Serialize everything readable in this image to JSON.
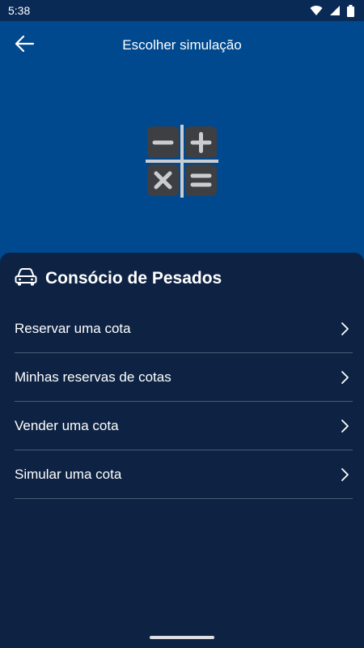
{
  "status_bar": {
    "time": "5:38"
  },
  "app_bar": {
    "title": "Escolher simulação",
    "back_icon": "arrow-left-icon"
  },
  "hero": {
    "icon": "calculator-icon"
  },
  "section": {
    "title": "Consócio de Pesados",
    "icon": "car-icon"
  },
  "menu": {
    "items": [
      {
        "label": "Reservar uma cota"
      },
      {
        "label": "Minhas reservas de cotas"
      },
      {
        "label": "Vender uma cota"
      },
      {
        "label": "Simular uma cota"
      }
    ]
  },
  "colors": {
    "primary": "#00498f",
    "sheet": "#0e2344",
    "divider": "#4a5a74",
    "text": "#ffffff"
  }
}
